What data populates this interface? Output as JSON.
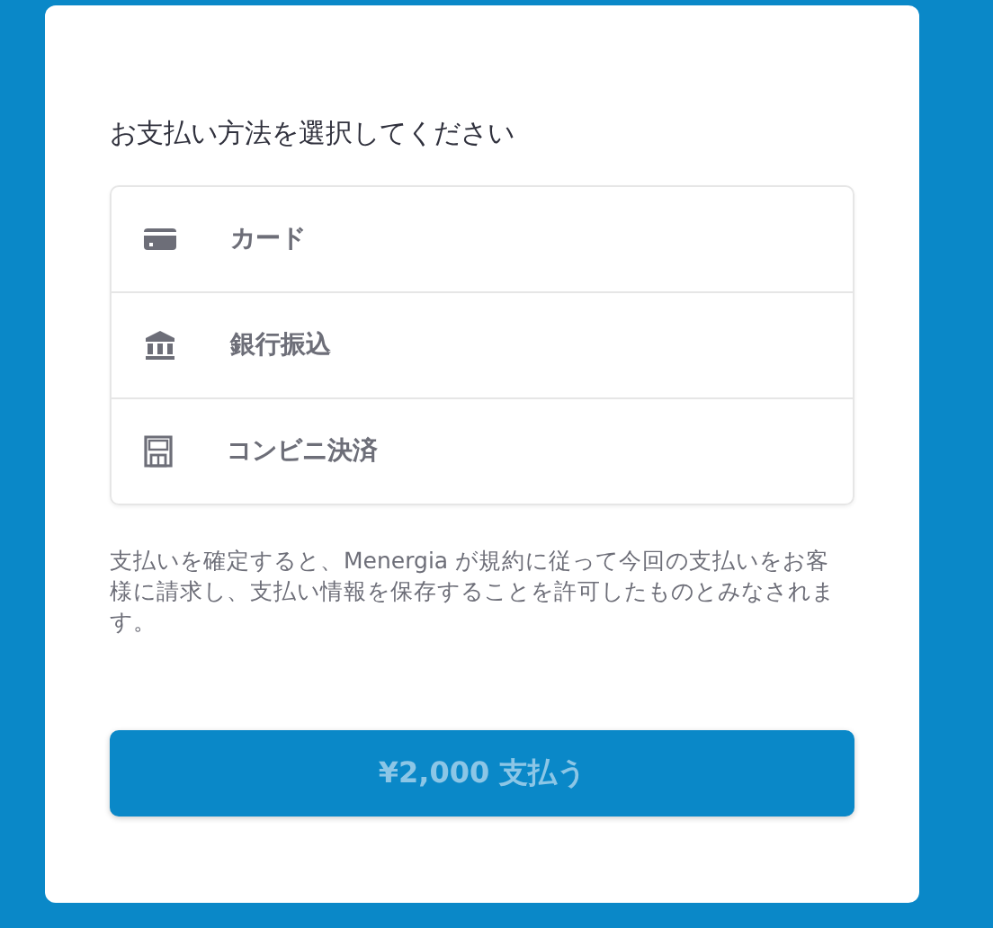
{
  "heading": "お支払い方法を選択してください",
  "methods": [
    {
      "kind": "card",
      "label": "カード"
    },
    {
      "kind": "bank",
      "label": "銀行振込"
    },
    {
      "kind": "store",
      "label": "コンビニ決済"
    }
  ],
  "notice": "支払いを確定すると、Menergia が規約に従って今回の支払いをお客様に請求し、支払い情報を保存することを許可したものとみなされます。",
  "pay_button": {
    "label": "¥2,000 支払う",
    "disabled": true
  }
}
